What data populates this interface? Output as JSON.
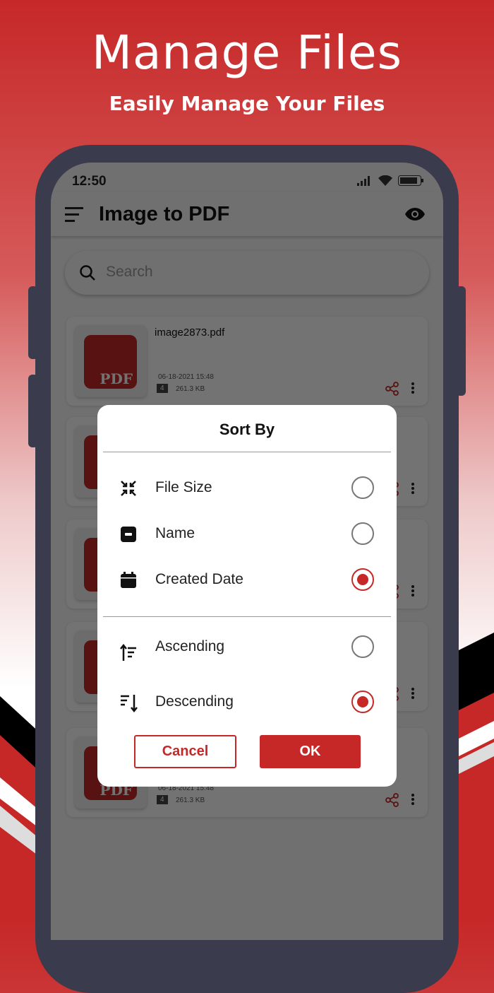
{
  "hero": {
    "title": "Manage Files",
    "subtitle": "Easily Manage Your Files"
  },
  "status_bar": {
    "time": "12:50"
  },
  "app_bar": {
    "title": "Image to PDF"
  },
  "search": {
    "placeholder": "Search"
  },
  "files": [
    {
      "name": "image2873.pdf",
      "date": "06-18-2021  15:48",
      "pages": "4",
      "size": "261.3 KB"
    },
    {
      "name": "",
      "date": "",
      "pages": "",
      "size": ""
    },
    {
      "name": "",
      "date": "",
      "pages": "",
      "size": ""
    },
    {
      "name": "",
      "date": "",
      "pages": "",
      "size": ""
    },
    {
      "name": "",
      "date": "06-18-2021  15:48",
      "pages": "4",
      "size": "261.3 KB"
    }
  ],
  "thumb_logo_text": "PDF",
  "dialog": {
    "title": "Sort By",
    "sort_fields": [
      {
        "label": "File Size",
        "icon": "compress-icon",
        "selected": false
      },
      {
        "label": "Name",
        "icon": "label-icon",
        "selected": false
      },
      {
        "label": "Created Date",
        "icon": "calendar-icon",
        "selected": true
      }
    ],
    "orders": [
      {
        "label": "Ascending",
        "icon": "sort-ascending-icon",
        "selected": false
      },
      {
        "label": "Descending",
        "icon": "sort-descending-icon",
        "selected": true
      }
    ],
    "cancel": "Cancel",
    "ok": "OK"
  },
  "colors": {
    "accent": "#c62828",
    "phone_frame": "#3a3b4d"
  }
}
